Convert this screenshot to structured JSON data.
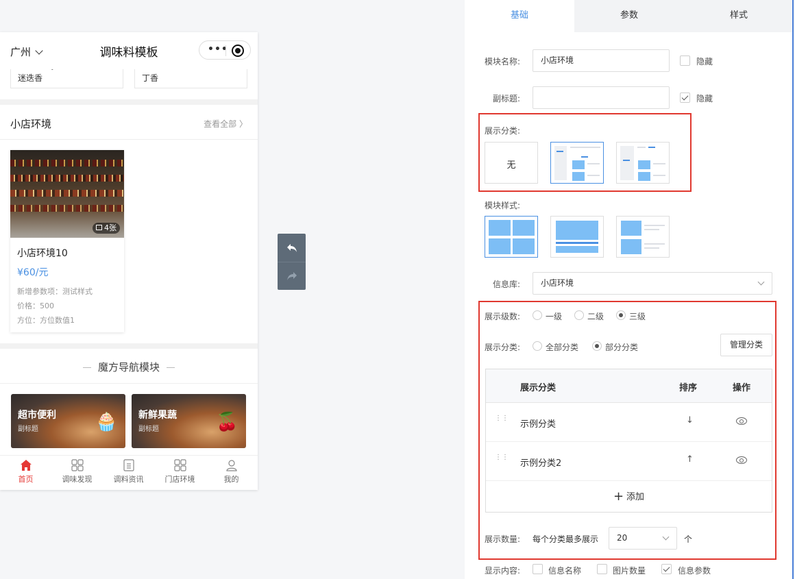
{
  "phone": {
    "city": "广州",
    "title": "调味料模板",
    "capsule_more": "•••",
    "herbs": [
      {
        "en": "Rosemary",
        "cn": "迷迭香"
      },
      {
        "en": "Cloves",
        "cn": "丁香"
      }
    ],
    "env_section": {
      "title": "小店环境",
      "more": "查看全部",
      "card": {
        "image_count": "4张",
        "name": "小店环境10",
        "price": "¥60/元",
        "meta": [
          "新增参数项：测试样式",
          "价格：500",
          "方位：方位数值1"
        ]
      }
    },
    "rubik": {
      "title": "魔方导航模块",
      "items": [
        {
          "title": "超市便利",
          "subtitle": "副标题",
          "icon": "muffin-icon"
        },
        {
          "title": "新鲜果蔬",
          "subtitle": "副标题",
          "icon": "cherry-icon"
        }
      ]
    },
    "tabbar": [
      {
        "label": "首页",
        "icon": "home-icon",
        "active": true
      },
      {
        "label": "调味发现",
        "icon": "grid-icon"
      },
      {
        "label": "调料资讯",
        "icon": "document-icon"
      },
      {
        "label": "门店环境",
        "icon": "grid-icon"
      },
      {
        "label": "我的",
        "icon": "user-icon"
      }
    ]
  },
  "toolbar": {
    "undo_icon": "undo-icon",
    "redo_icon": "redo-icon"
  },
  "panel": {
    "tabs": [
      "基础",
      "参数",
      "样式"
    ],
    "active_tab": "基础",
    "module_name_label": "模块名称:",
    "module_name_value": "小店环境",
    "hide_label": "隐藏",
    "subtitle_label": "副标题:",
    "subtitle_value": "",
    "hide_label_2": "隐藏",
    "show_category_label": "展示分类:",
    "category_none": "无",
    "module_style_label": "模块样式:",
    "info_lib_label": "信息库:",
    "info_lib_value": "小店环境",
    "level_label": "展示级数:",
    "levels": [
      "一级",
      "二级",
      "三级"
    ],
    "selected_level": "三级",
    "category_scope_label": "展示分类:",
    "scopes": [
      "全部分类",
      "部分分类"
    ],
    "selected_scope": "部分分类",
    "manage_button": "管理分类",
    "table": {
      "headers": [
        "展示分类",
        "排序",
        "操作"
      ],
      "rows": [
        {
          "name": "示例分类",
          "sort": "↓"
        },
        {
          "name": "示例分类2",
          "sort": "↑"
        }
      ],
      "add_label": "添加"
    },
    "count_label": "展示数量:",
    "count_prefix": "每个分类最多展示",
    "count_value": "20",
    "count_unit": "个",
    "content_label": "显示内容:",
    "content_options": [
      {
        "label": "信息名称",
        "checked": false
      },
      {
        "label": "图片数量",
        "checked": false
      },
      {
        "label": "信息参数",
        "checked": true
      }
    ]
  }
}
